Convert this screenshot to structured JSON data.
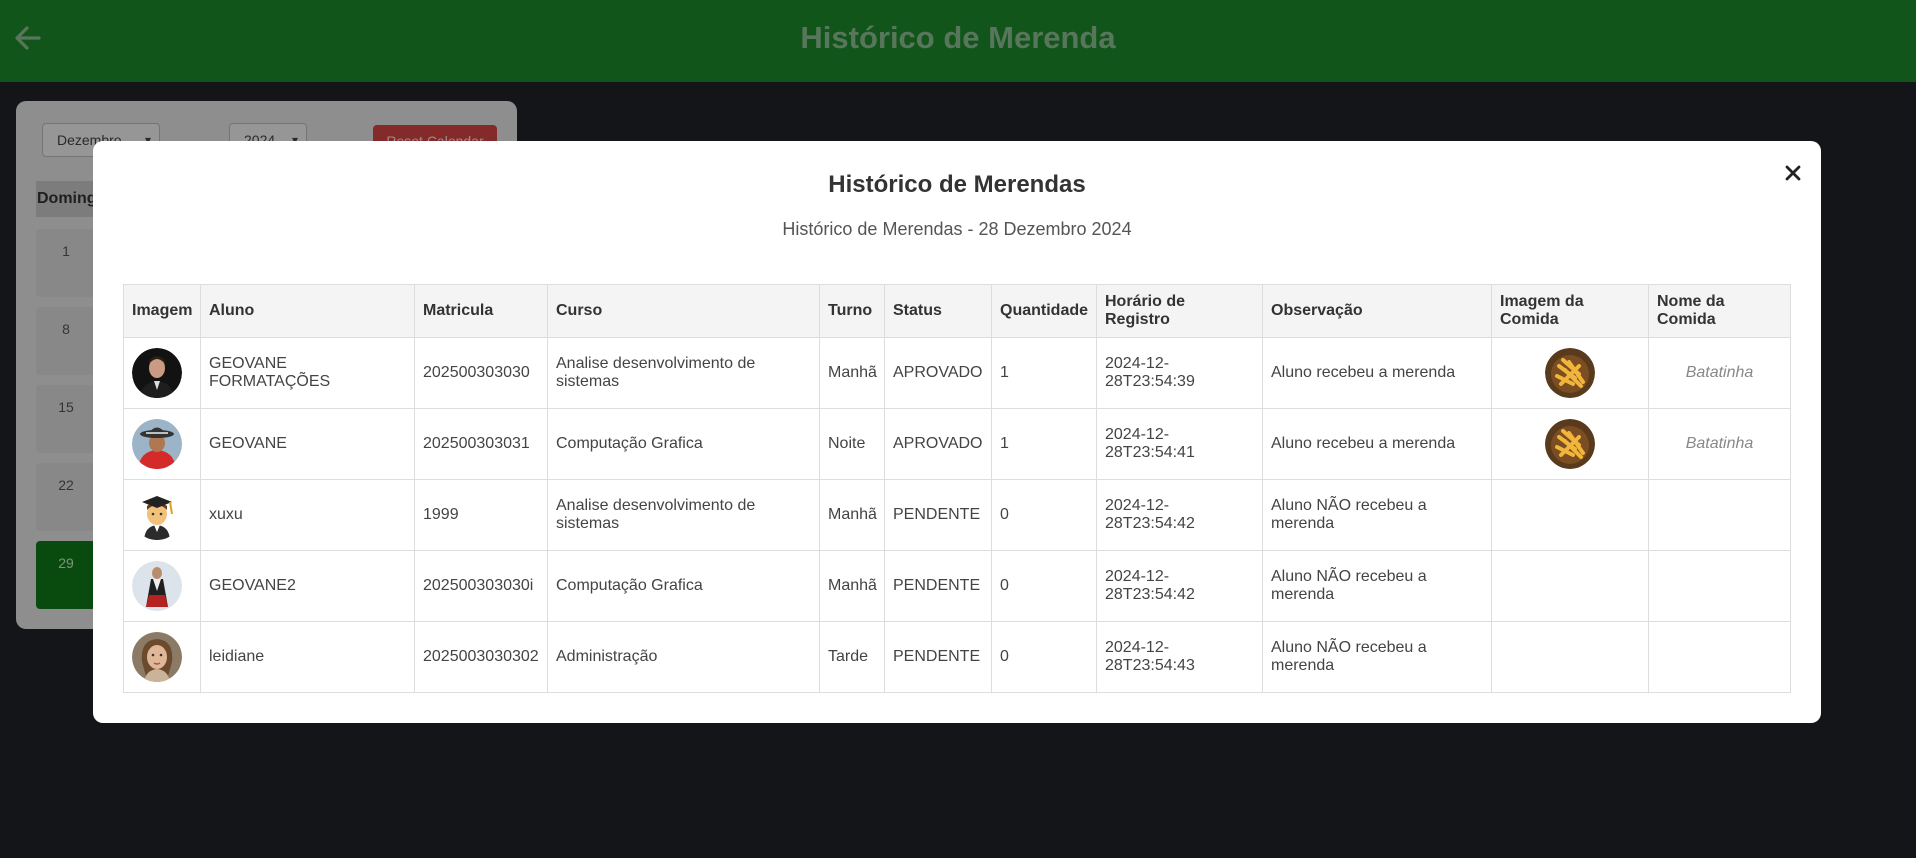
{
  "header": {
    "title": "Histórico de Merenda",
    "back_icon": "arrow-left-icon"
  },
  "calendar": {
    "month": "Dezembro",
    "year": "2024",
    "reset_label": "Reset Calendar",
    "weekday_header": "Doming",
    "days": [
      "1",
      "8",
      "15",
      "22",
      "29"
    ],
    "today": "29"
  },
  "modal": {
    "title": "Histórico de Merendas",
    "subtitle": "Histórico de Merendas - 28 Dezembro 2024",
    "close_icon": "close-icon",
    "columns": [
      "Imagem",
      "Aluno",
      "Matricula",
      "Curso",
      "Turno",
      "Status",
      "Quantidade",
      "Horário de Registro",
      "Observação",
      "Imagem da Comida",
      "Nome da Comida"
    ],
    "rows": [
      {
        "aluno": "GEOVANE FORMATAÇÕES",
        "matricula": "202500303030",
        "curso": "Analise desenvolvimento de sistemas",
        "turno": "Manhã",
        "status": "APROVADO",
        "quantidade": "1",
        "horario": "2024-12-28T23:54:39",
        "observacao": "Aluno recebeu a merenda",
        "comida": "Batatinha",
        "avatar_icon": "man-suit-avatar",
        "has_food": true
      },
      {
        "aluno": "GEOVANE",
        "matricula": "202500303031",
        "curso": "Computação Grafica",
        "turno": "Noite",
        "status": "APROVADO",
        "quantidade": "1",
        "horario": "2024-12-28T23:54:41",
        "observacao": "Aluno recebeu a merenda",
        "comida": "Batatinha",
        "avatar_icon": "person-hat-avatar",
        "has_food": true
      },
      {
        "aluno": "xuxu",
        "matricula": "1999",
        "curso": "Analise desenvolvimento de sistemas",
        "turno": "Manhã",
        "status": "PENDENTE",
        "quantidade": "0",
        "horario": "2024-12-28T23:54:42",
        "observacao": "Aluno NÃO recebeu a merenda",
        "comida": "",
        "avatar_icon": "student-emoji-avatar",
        "has_food": false
      },
      {
        "aluno": "GEOVANE2",
        "matricula": "202500303030i",
        "curso": "Computação Grafica",
        "turno": "Manhã",
        "status": "PENDENTE",
        "quantidade": "0",
        "horario": "2024-12-28T23:54:42",
        "observacao": "Aluno NÃO recebeu a merenda",
        "comida": "",
        "avatar_icon": "dress-figure-avatar",
        "has_food": false
      },
      {
        "aluno": "leidiane",
        "matricula": "2025003030302",
        "curso": "Administração",
        "turno": "Tarde",
        "status": "PENDENTE",
        "quantidade": "0",
        "horario": "2024-12-28T23:54:43",
        "observacao": "Aluno NÃO recebeu a merenda",
        "comida": "",
        "avatar_icon": "woman-portrait-avatar",
        "has_food": false
      }
    ]
  },
  "colors": {
    "header_green": "#1d8a2c",
    "today_green": "#0f7a18",
    "reset_red": "#d64545",
    "background": "#202227"
  }
}
